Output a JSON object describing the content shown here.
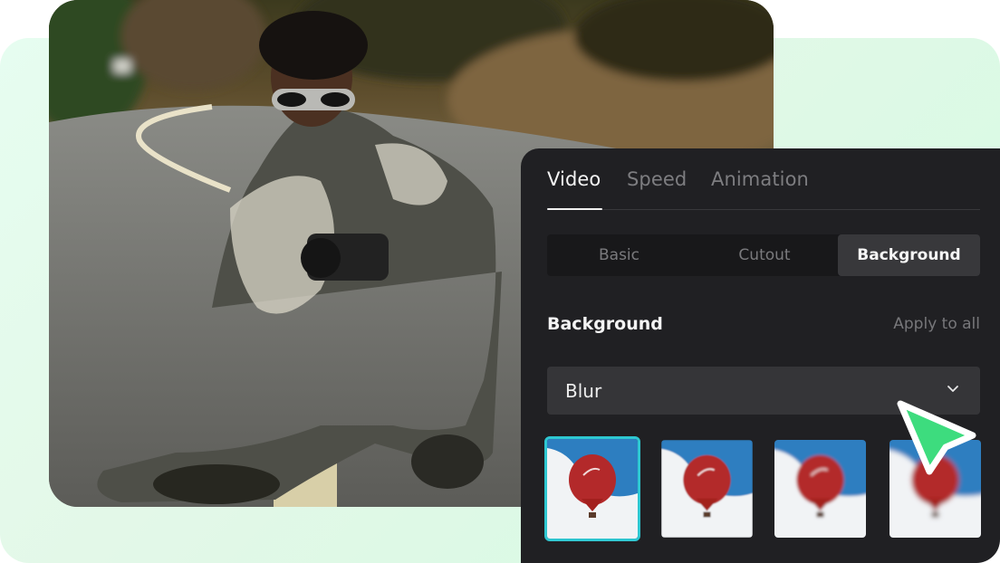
{
  "panel": {
    "tabs": [
      {
        "label": "Video",
        "active": true
      },
      {
        "label": "Speed",
        "active": false
      },
      {
        "label": "Animation",
        "active": false
      }
    ],
    "segments": [
      {
        "label": "Basic",
        "active": false
      },
      {
        "label": "Cutout",
        "active": false
      },
      {
        "label": "Background",
        "active": true
      }
    ],
    "section_title": "Background",
    "apply_to_all": "Apply to all",
    "dropdown": {
      "value": "Blur",
      "icon": "chevron-down-icon"
    },
    "thumbnails": [
      {
        "label": "blur-level-1",
        "blur": 0,
        "selected": true
      },
      {
        "label": "blur-level-2",
        "blur": 1,
        "selected": false
      },
      {
        "label": "blur-level-3",
        "blur": 2,
        "selected": false
      },
      {
        "label": "blur-level-4",
        "blur": 3,
        "selected": false
      }
    ]
  },
  "colors": {
    "panel_bg": "#202023",
    "accent_selected": "#2ec7d1",
    "cursor_fill": "#3ddc7e",
    "background_shape": "#dcfbe8"
  },
  "photo": {
    "subject": "man in tie-dye hoodie and sunglasses sitting on road holding camera"
  }
}
